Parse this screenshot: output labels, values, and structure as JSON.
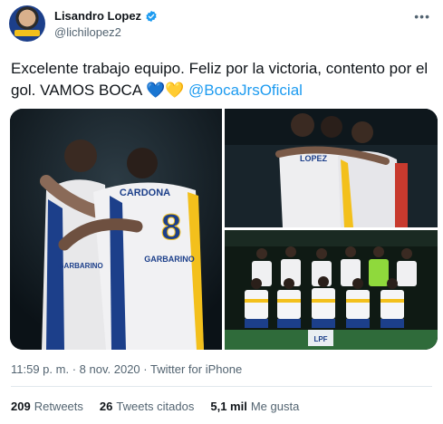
{
  "author": {
    "display_name": "Lisandro Lopez",
    "handle": "@lichilopez2",
    "verified": true
  },
  "tweet": {
    "text_main": "Excelente trabajo equipo. Feliz por la victoria, contento por el gol. VAMOS BOCA",
    "emoji_1": "💙",
    "emoji_2": "💛",
    "mention": "@BocaJrsOficial"
  },
  "media": {
    "jersey_name": "CARDONA",
    "jersey_number": "8",
    "sponsor": "GARBARINO",
    "jersey_name_2": "LOPEZ",
    "board_logo": "LPF"
  },
  "meta": {
    "time": "11:59 p. m.",
    "date": "8 nov. 2020",
    "source": "Twitter for iPhone",
    "separator": "·"
  },
  "stats": [
    {
      "value": "209",
      "label": "Retweets"
    },
    {
      "value": "26",
      "label": "Tweets citados"
    },
    {
      "value": "5,1 mil",
      "label": "Me gusta"
    }
  ],
  "colors": {
    "accent": "#1d9bf0",
    "text": "#0f1419",
    "muted": "#536471",
    "boca_blue": "#1c3f8a",
    "boca_yellow": "#f3c01c"
  }
}
